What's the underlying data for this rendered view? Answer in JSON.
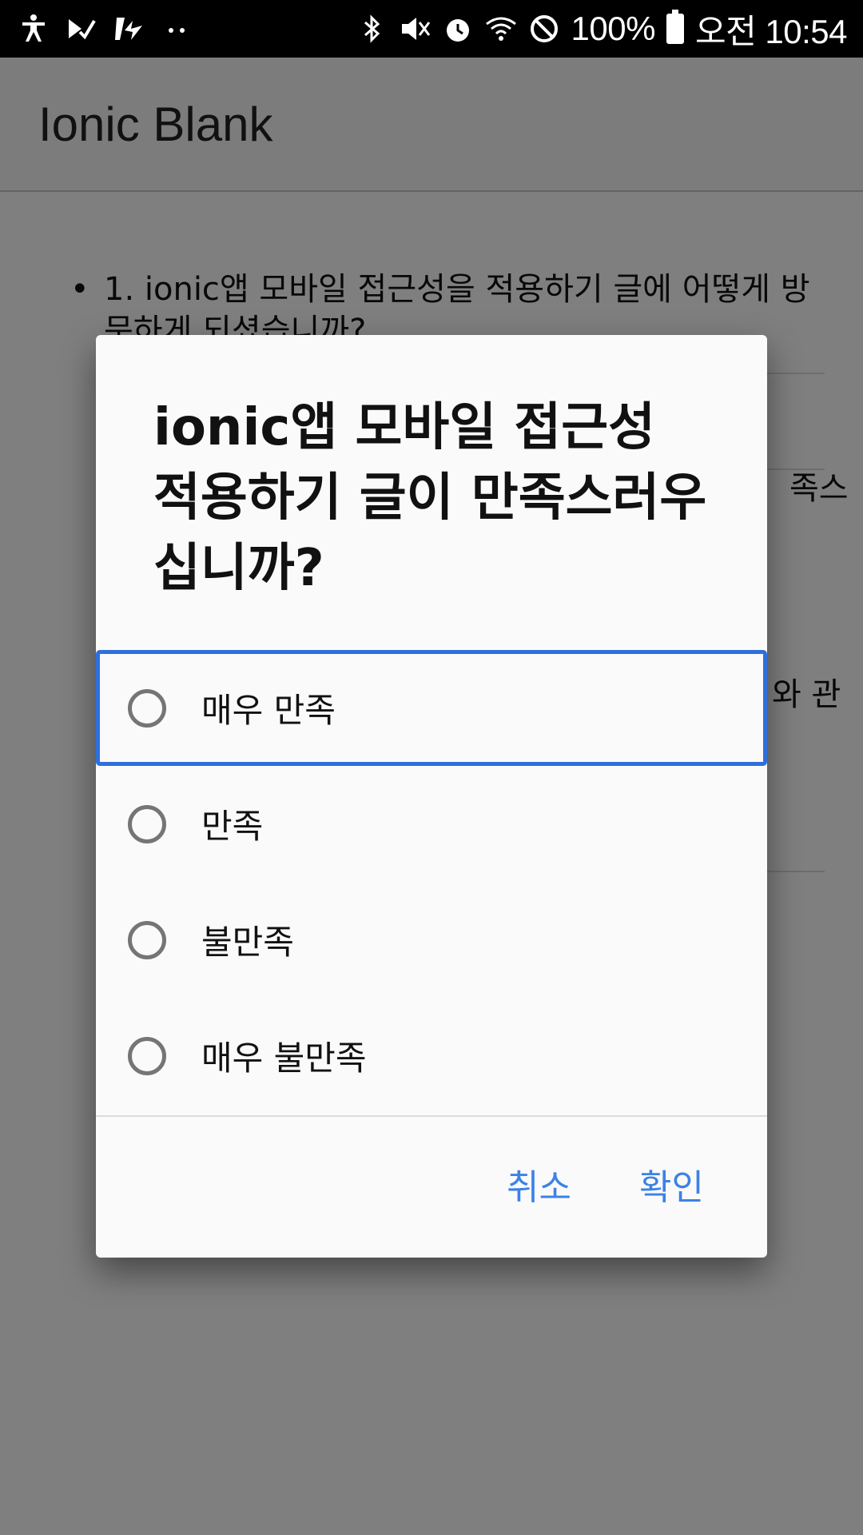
{
  "status_bar": {
    "battery_text": "100%",
    "time": "오전 10:54",
    "icons": [
      "accessibility-icon",
      "check-icon",
      "usb-icon",
      "more-dots-icon",
      "bluetooth-icon",
      "mute-icon",
      "alarm-icon",
      "wifi-icon",
      "blocked-icon",
      "battery-icon"
    ]
  },
  "app": {
    "title": "Ionic Blank",
    "question1": "1. ionic앱 모바일 접근성을 적용하기 글에 어떻게 방문하게 되셨습니까?",
    "fragment_right_1": "족스",
    "fragment_right_2": "와 관"
  },
  "dialog": {
    "title": "ionic앱 모바일 접근성 적용하기 글이 만족스러우십니까?",
    "options": [
      {
        "label": "매우 만족"
      },
      {
        "label": "만족"
      },
      {
        "label": "불만족"
      },
      {
        "label": "매우 불만족"
      }
    ],
    "cancel_label": "취소",
    "ok_label": "확인"
  },
  "colors": {
    "accent": "#3c82e6",
    "focus_ring": "#2f6fdc",
    "radio": "#757575"
  }
}
